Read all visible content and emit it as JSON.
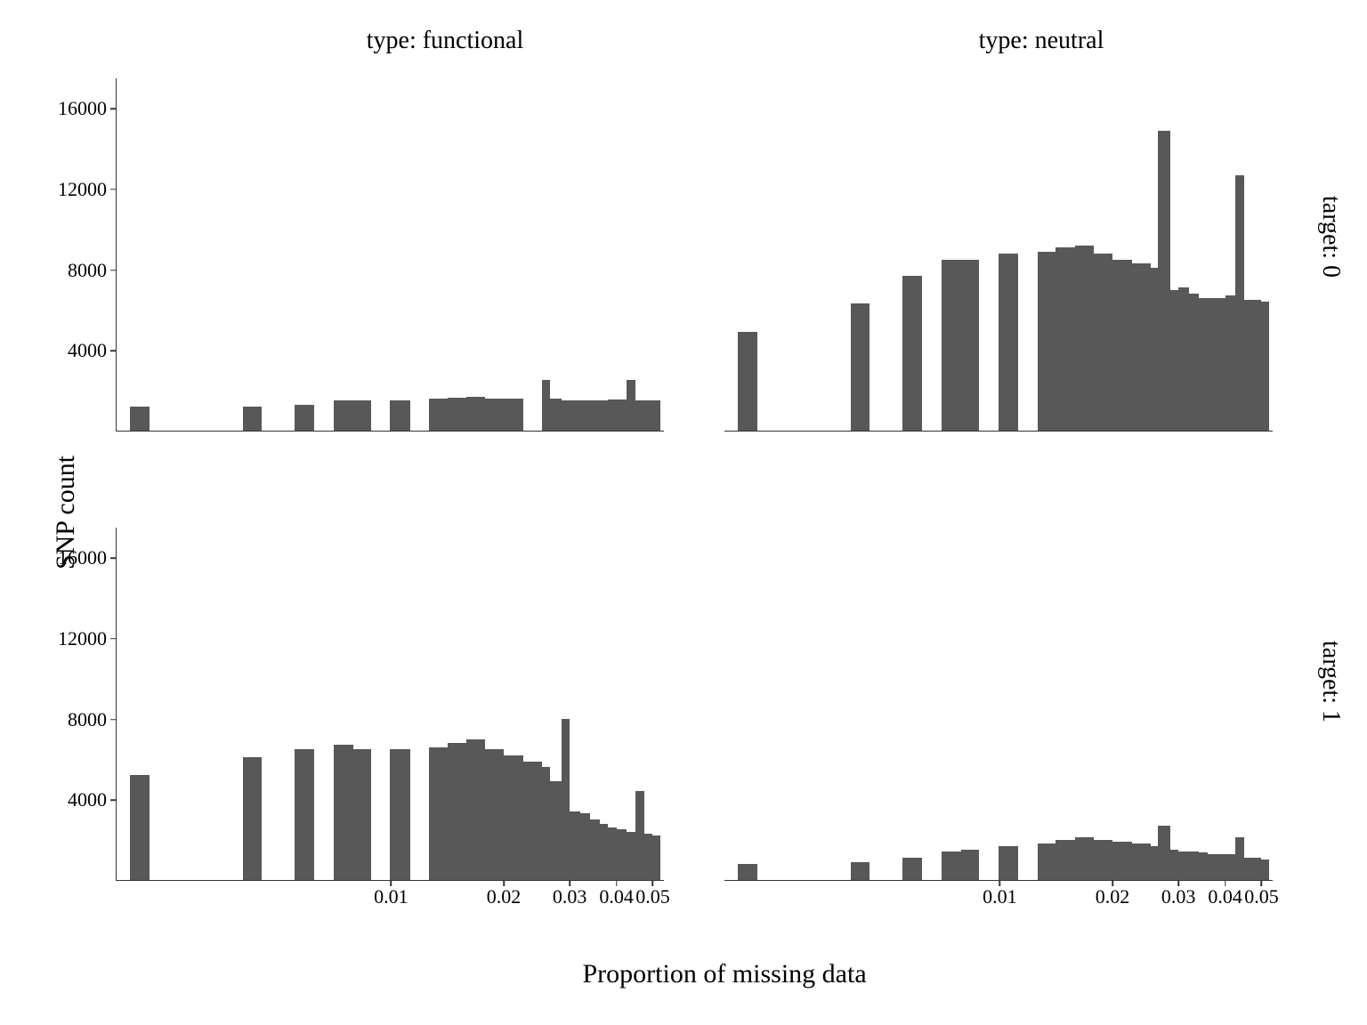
{
  "chart_data": {
    "type": "bar",
    "xlabel": "Proportion of missing data",
    "ylabel": "SNP count",
    "x_scale": "log",
    "col_facet_var": "type",
    "row_facet_var": "target",
    "col_levels": [
      "functional",
      "neutral"
    ],
    "row_levels": [
      "0",
      "1"
    ],
    "col_titles": [
      "type: functional",
      "type: neutral"
    ],
    "row_titles": [
      "target: 0",
      "target: 1"
    ],
    "y_ticks": [
      4000,
      8000,
      12000,
      16000
    ],
    "y_tick_labels": [
      "4000",
      "8000",
      "12000",
      "16000"
    ],
    "x_ticks": [
      0.01,
      0.02,
      0.03,
      0.04,
      0.05
    ],
    "x_tick_labels": [
      "0.01",
      "0.02",
      "0.03",
      "0.04",
      "0.05"
    ],
    "ylim": [
      0,
      17500
    ],
    "x_edges": [
      0.002,
      0.00225,
      0.004,
      0.0045,
      0.0055,
      0.0062,
      0.007,
      0.0079,
      0.0088,
      0.0099,
      0.0112,
      0.0126,
      0.0141,
      0.0159,
      0.0178,
      0.02,
      0.0225,
      0.0253,
      0.0265,
      0.0285,
      0.03,
      0.032,
      0.034,
      0.036,
      0.038,
      0.04,
      0.0425,
      0.045,
      0.0475,
      0.05,
      0.0525
    ],
    "series_matrix": {
      "functional_0": [
        1200,
        0,
        1200,
        0,
        1300,
        0,
        1500,
        1500,
        0,
        1500,
        0,
        1600,
        1650,
        1700,
        1600,
        1600,
        0,
        2500,
        1600,
        1500,
        1500,
        1500,
        1500,
        1500,
        1550,
        1550,
        2500,
        1500,
        1500,
        1500
      ],
      "neutral_0": [
        4900,
        0,
        6300,
        0,
        7700,
        0,
        8500,
        8500,
        0,
        8800,
        0,
        8900,
        9100,
        9200,
        8800,
        8500,
        8300,
        8100,
        14900,
        7000,
        7100,
        6800,
        6600,
        6600,
        6600,
        6700,
        12700,
        6500,
        6500,
        6400
      ],
      "functional_1": [
        5200,
        0,
        6100,
        0,
        6500,
        0,
        6700,
        6500,
        0,
        6500,
        0,
        6600,
        6800,
        7000,
        6500,
        6200,
        5900,
        5600,
        4900,
        8000,
        3400,
        3300,
        3000,
        2800,
        2600,
        2500,
        2400,
        4400,
        2300,
        2200
      ],
      "neutral_1": [
        800,
        0,
        900,
        0,
        1100,
        0,
        1400,
        1500,
        0,
        1700,
        0,
        1800,
        2000,
        2100,
        2000,
        1900,
        1800,
        1700,
        2700,
        1500,
        1400,
        1400,
        1350,
        1300,
        1300,
        1300,
        2100,
        1100,
        1100,
        1000
      ]
    }
  }
}
